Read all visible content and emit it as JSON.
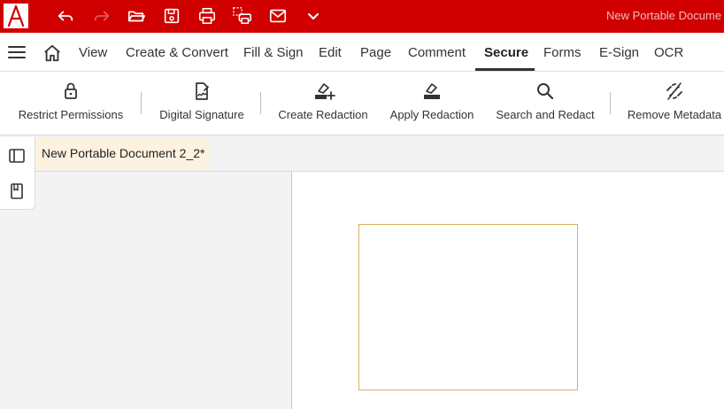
{
  "app": {
    "window_title": "New Portable Docume",
    "brand_color": "#d00000",
    "logo_letter": "A"
  },
  "quick_access": {
    "icons": [
      "undo-icon",
      "redo-icon",
      "open-folder-icon",
      "save-icon",
      "print-icon",
      "print-preview-icon",
      "mail-icon",
      "chevron-down-icon"
    ]
  },
  "menu": {
    "items": [
      "View",
      "Create & Convert",
      "Fill & Sign",
      "Edit",
      "Page",
      "Comment",
      "Secure",
      "Forms",
      "E-Sign",
      "OCR"
    ],
    "active": "Secure"
  },
  "ribbon": {
    "tools": [
      {
        "label": "Restrict Permissions",
        "icon": "lock-icon"
      },
      {
        "label": "Digital Signature",
        "icon": "signed-document-icon"
      },
      {
        "label": "Create Redaction",
        "icon": "create-redaction-icon"
      },
      {
        "label": "Apply Redaction",
        "icon": "apply-redaction-icon"
      },
      {
        "label": "Search and Redact",
        "icon": "search-icon"
      },
      {
        "label": "Remove Metadata",
        "icon": "remove-metadata-icon"
      }
    ]
  },
  "document": {
    "tab_title": "New Portable Document 2_2*",
    "tab_color": "#fdf2e0",
    "redaction_color": "#d8b15c"
  },
  "side_panel": {
    "icons": [
      "panel-toggle-icon",
      "bookmark-icon"
    ]
  }
}
